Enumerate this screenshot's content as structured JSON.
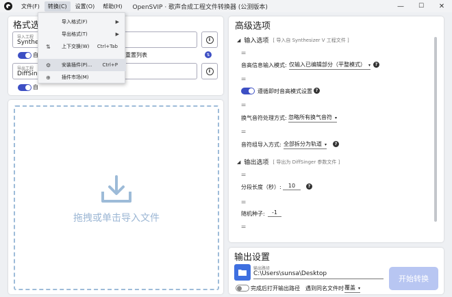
{
  "menubar": {
    "items": [
      "文件(F)",
      "转换(C)",
      "设置(O)",
      "帮助(H)"
    ],
    "active_index": 1,
    "title": "OpenSVIP · 歌声合成工程文件转换器 (公测版本)"
  },
  "window_controls": {
    "minimize": "—",
    "maximize": "☐",
    "close": "✕"
  },
  "format_card": {
    "title": "格式选",
    "import_label": "导入工程",
    "import_value": "Synthe",
    "reset_label": "重置列表",
    "export_label": "导出工程",
    "export_value": "DiffSing",
    "auto_label_1": "自",
    "auto_label_2": "自"
  },
  "convert_menu": {
    "items": [
      {
        "icon": "",
        "label": "导入格式(F)",
        "shortcut": "",
        "submenu": true
      },
      {
        "icon": "",
        "label": "导出格式(T)",
        "shortcut": "",
        "submenu": true
      },
      {
        "icon": "⇅",
        "label": "上下交换(W)",
        "shortcut": "Ctrl+Tab",
        "submenu": false
      },
      {
        "icon": "⚙",
        "label": "安装插件(P)...",
        "shortcut": "Ctrl+P",
        "submenu": false,
        "highlighted": true
      },
      {
        "icon": "⊕",
        "label": "插件市场(M)",
        "shortcut": "",
        "submenu": false
      }
    ]
  },
  "dropzone": {
    "text": "拖拽或单击导入文件"
  },
  "advanced": {
    "title": "高级选项",
    "input_section": {
      "title": "输入选项",
      "subtitle": "[ 导入自 Synthesizer V 工程文件 ]"
    },
    "options_input": [
      {
        "label": "音高信息输入模式:",
        "value": "仅输入已编辑部分（平整模式）",
        "type": "select"
      },
      {
        "label": "遵循即时音高模式设置",
        "type": "toggle"
      },
      {
        "label": "换气音符处理方式:",
        "value": "忽略所有换气音符",
        "type": "select"
      },
      {
        "label": "音符组导入方式:",
        "value": "全部拆分为轨道",
        "type": "select"
      }
    ],
    "output_section": {
      "title": "输出选项",
      "subtitle": "[ 导出为 DiffSinger 参数文件 ]"
    },
    "options_output": [
      {
        "label": "分段长度（秒）:",
        "value": "10"
      },
      {
        "label": "随机种子:",
        "value": "-1"
      }
    ]
  },
  "output_settings": {
    "title": "输出设置",
    "path_label": "输出路径",
    "path_value": "C:\\Users\\sunsa\\Desktop",
    "open_after_label": "完成后打开输出路径",
    "conflict_label": "遇到同名文件时",
    "conflict_value": "覆盖",
    "start_button": "开始转换"
  },
  "colors": {
    "accent": "#3d4fc4",
    "folder_button": "#3e6fe0",
    "start_button_disabled": "#b8c6f2",
    "dropzone_border": "#9dbbd8"
  }
}
